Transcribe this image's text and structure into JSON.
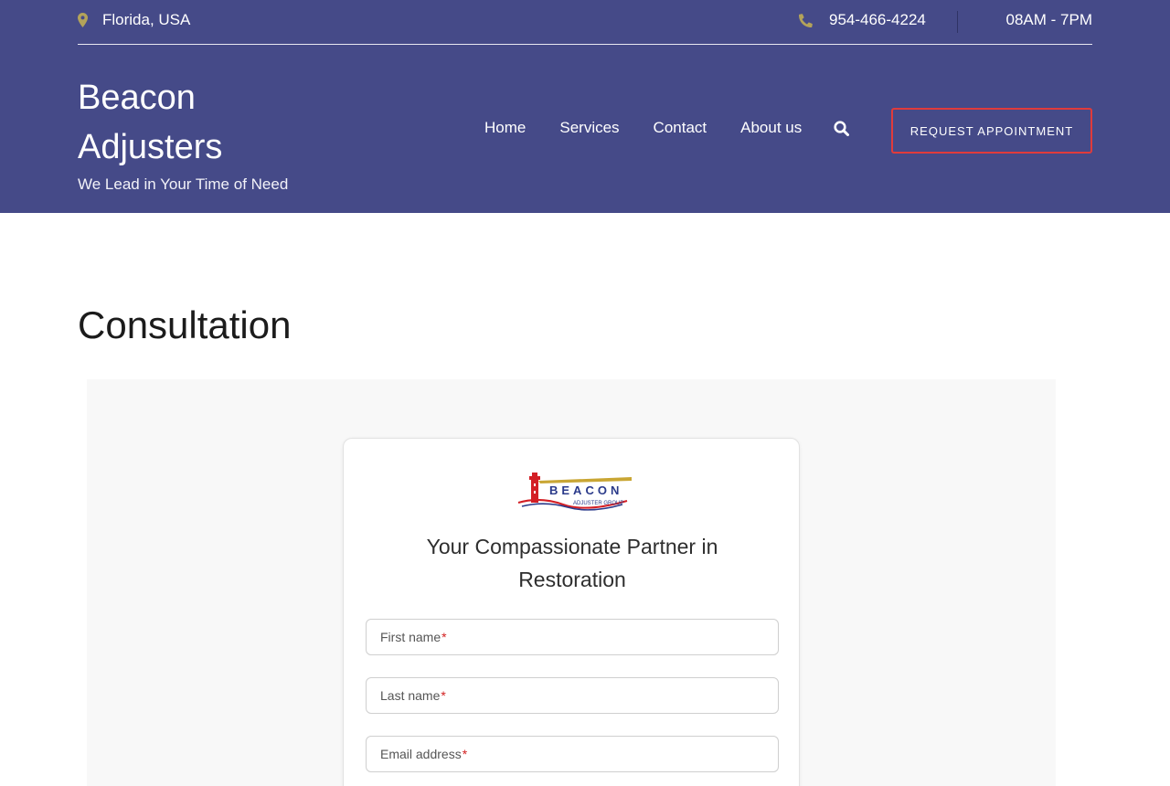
{
  "topbar": {
    "location": "Florida, USA",
    "phone": "954-466-4224",
    "hours": "08AM - 7PM",
    "location_icon": "map-marker-icon",
    "phone_icon": "phone-icon"
  },
  "brand": {
    "name": "Beacon Adjusters",
    "tagline": "We Lead in Your Time of Need"
  },
  "nav": {
    "items": [
      "Home",
      "Services",
      "Contact",
      "About us"
    ],
    "search_icon": "search-icon"
  },
  "cta": {
    "label": "REQUEST APPOINTMENT"
  },
  "main": {
    "title": "Consultation"
  },
  "form": {
    "logo_text": "BEACON",
    "logo_subtext": "ADJUSTER GROUP",
    "heading": "Your Compassionate Partner in Restoration",
    "fields": [
      {
        "label": "First name",
        "required_mark": "*"
      },
      {
        "label": "Last name",
        "required_mark": "*"
      },
      {
        "label": "Email address",
        "required_mark": "*"
      }
    ]
  },
  "colors": {
    "header_bg": "#454a88",
    "icon_gold": "#b3a35a",
    "cta_border": "#e03b3b",
    "required": "#d21f1f",
    "form_bg": "#f8f8f8"
  }
}
